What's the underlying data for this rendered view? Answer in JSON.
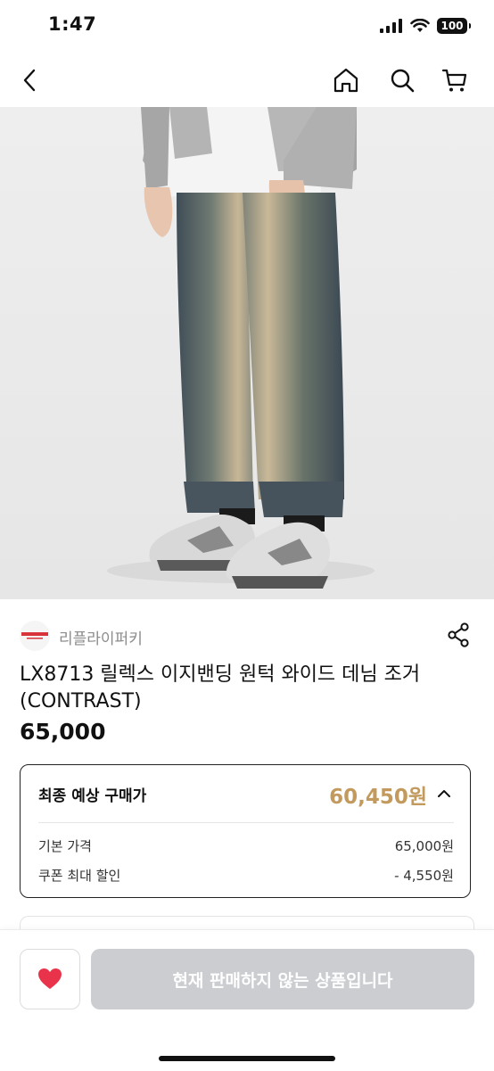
{
  "status_bar": {
    "time": "1:47",
    "battery": "100"
  },
  "nav": {
    "icons": [
      "back-chevron-icon",
      "home-icon",
      "search-icon",
      "cart-icon"
    ]
  },
  "product": {
    "image_alt_name": "product-photo-denim-jogger",
    "brand_logo_text": "REPLY PERKY",
    "brand": "리플라이퍼키",
    "title": "LX8713 릴렉스 이지밴딩 원턱 와이드 데님 조거 (CONTRAST)",
    "price": "65,000"
  },
  "price_box": {
    "final_label": "최종 예상 구매가",
    "final_value": "60,450원",
    "rows": [
      {
        "label": "기본 가격",
        "value": "65,000원"
      },
      {
        "label": "쿠폰 최대 할인",
        "value": "- 4,550원"
      }
    ],
    "accent_color": "#c29a5d"
  },
  "bottom_bar": {
    "buy_label": "현재 판매하지 않는 상품입니다",
    "heart_color": "#e8334a",
    "buy_bg": "#cbcdd1"
  }
}
